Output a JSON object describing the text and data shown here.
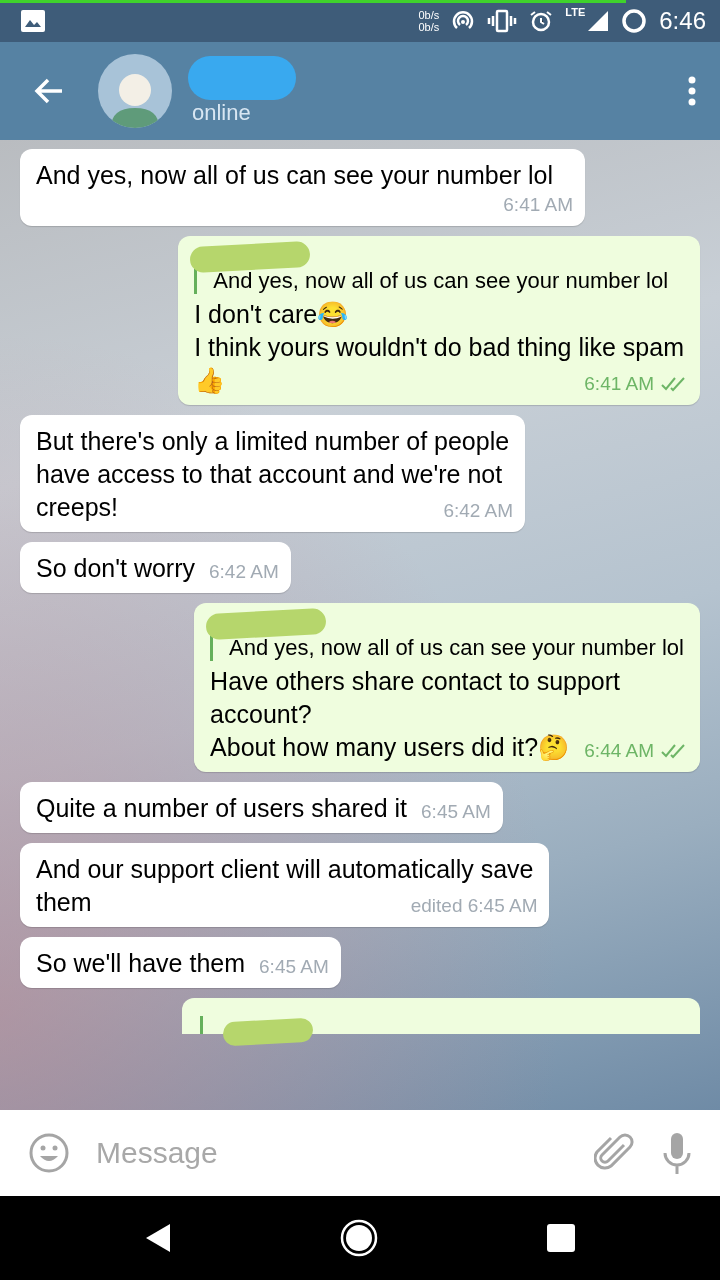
{
  "status_bar": {
    "progress": {
      "level": 0.87
    },
    "speed_up": "0b/s",
    "speed_down": "0b/s",
    "network": "LTE",
    "time": "6:46"
  },
  "header": {
    "name_hidden": true,
    "status": "online"
  },
  "messages": [
    {
      "kind": "in",
      "lines": [
        {
          "text": "And yes, now all of us can see your number lol"
        }
      ],
      "time": "6:41 AM"
    },
    {
      "kind": "out",
      "reply": {
        "sender_hidden": true,
        "text": "And yes, now all of us can see your number lol"
      },
      "lines": [
        {
          "text": "I don't care😂"
        },
        {
          "text": "I think yours wouldn't do bad thing like spam"
        },
        {
          "text": "👍"
        }
      ],
      "time": "6:41 AM",
      "read": true
    },
    {
      "kind": "in",
      "lines": [
        {
          "text": "But there's only a limited number of people"
        },
        {
          "text": "have access to that account and we're not"
        },
        {
          "text": "creeps!"
        }
      ],
      "time": "6:42 AM"
    },
    {
      "kind": "in",
      "lines": [
        {
          "text": "So don't worry"
        }
      ],
      "time": "6:42 AM"
    },
    {
      "kind": "out",
      "reply": {
        "sender_hidden": true,
        "text": "And yes, now all of us can see your number lol"
      },
      "lines": [
        {
          "text": "Have others share contact to support"
        },
        {
          "text": "account?"
        },
        {
          "text": "About how many users did it?🤔"
        }
      ],
      "time": "6:44 AM",
      "read": true
    },
    {
      "kind": "in",
      "lines": [
        {
          "text": "Quite a number of users shared it"
        }
      ],
      "time": "6:45 AM"
    },
    {
      "kind": "in",
      "lines": [
        {
          "text": "And our support client will automatically save"
        },
        {
          "text": "them"
        }
      ],
      "time": "edited 6:45 AM"
    },
    {
      "kind": "in",
      "lines": [
        {
          "text": "So we'll have them"
        }
      ],
      "time": "6:45 AM"
    },
    {
      "kind": "cut",
      "reply": {
        "sender_hidden": true
      }
    }
  ],
  "composer": {
    "placeholder": "Message"
  }
}
